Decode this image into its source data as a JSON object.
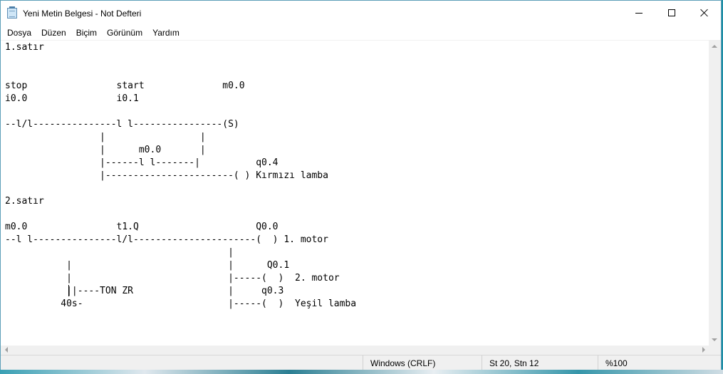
{
  "window": {
    "title": "Yeni Metin Belgesi - Not Defteri",
    "icon": "notepad-icon"
  },
  "menu": {
    "items": [
      "Dosya",
      "Düzen",
      "Biçim",
      "Görünüm",
      "Yardım"
    ]
  },
  "editor": {
    "text": "1.satır\n\n\nstop                start              m0.0\ni0.0                i0.1\n\n--l/l---------------l l----------------(S)\n                 |                 |\n                 |      m0.0       |\n                 |------l l-------|          q0.4\n                 |-----------------------( ) Kırmızı lamba\n\n2.satır\n\nm0.0                t1.Q                     Q0.0\n--l l---------------l/l----------------------(  ) 1. motor\n                                        |\n           |                            |      Q0.1\n           |                            |-----(  )  2. motor\n           ||----TON ZR                 |     q0.3\n          40s-                          |-----(  )  Yeşil lamba"
  },
  "status": {
    "eol": "Windows (CRLF)",
    "position": "St 20, Stn 12",
    "zoom": "%100"
  },
  "colors": {
    "window_bg": "#ffffff",
    "statusbar_bg": "#f0f0f0",
    "desktop": "#1f8fa6"
  }
}
